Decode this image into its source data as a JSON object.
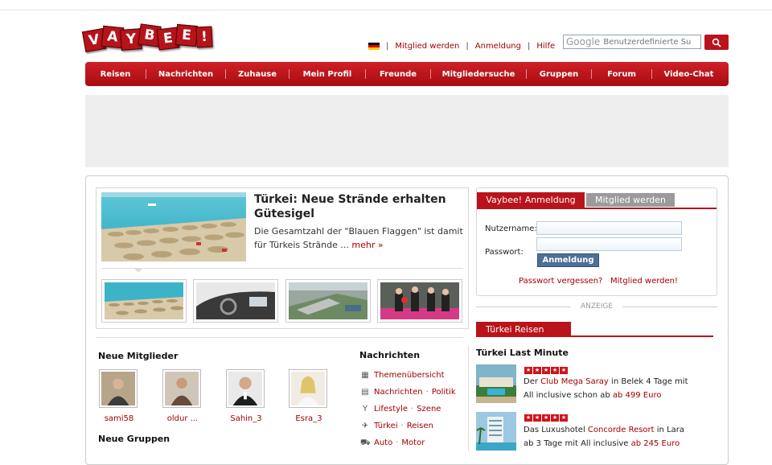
{
  "logo": {
    "letters": [
      "V",
      "A",
      "Y",
      "B",
      "E",
      "E",
      "!"
    ]
  },
  "toplinks": {
    "flag": "german-flag",
    "items": [
      "Mitglied werden",
      "Anmeldung",
      "Hilfe"
    ]
  },
  "search": {
    "brand": "Google",
    "placeholder": "Benutzerdefinierte Su"
  },
  "nav": [
    "Reisen",
    "Nachrichten",
    "Zuhause",
    "Mein Profil",
    "Freunde",
    "Mitgliedersuche",
    "Gruppen",
    "Forum",
    "Video-Chat"
  ],
  "feature": {
    "title": "Türkei: Neue Strände erhalten Gütesigel",
    "text": "Die Gesamtzahl der \"Blauen Flaggen\" ist damit für Türkeis Strände ...",
    "more": "mehr »"
  },
  "login": {
    "tab_active": "Vaybee! Anmeldung",
    "tab_inactive": "Mitglied werden",
    "username_label": "Nutzername:",
    "password_label": "Passwort:",
    "button": "Anmeldung",
    "forgot": "Passwort vergessen?",
    "register": "Mitglied werden!"
  },
  "anzeige": "ANZEIGE",
  "reisen": {
    "tab": "Türkei Reisen",
    "heading": "Türkei Last Minute",
    "offers": [
      {
        "line1_pre": "Der ",
        "hotel": "Club Mega Saray",
        "line1_post": " in Belek 4 Tage mit",
        "line2_pre": "All inclusive schon ab ",
        "price": "ab 499 Euro",
        "stars": 5
      },
      {
        "line1_pre": "Das Luxushotel ",
        "hotel": "Concorde Resort",
        "line1_post": " in Lara",
        "line2_pre": "ab 3 Tage mit All inclusive ",
        "price": "ab 245 Euro",
        "stars": 5
      }
    ]
  },
  "members": {
    "heading": "Neue Mitglieder",
    "items": [
      "sami58",
      "oldur ...",
      "Sahin_3",
      "Esra_3"
    ]
  },
  "groups": {
    "heading": "Neue Gruppen"
  },
  "news": {
    "heading": "Nachrichten",
    "items": [
      {
        "icon": "grid-icon",
        "a": "Themenübersicht",
        "b": ""
      },
      {
        "icon": "newspaper-icon",
        "a": "Nachrichten",
        "b": "Politik"
      },
      {
        "icon": "cocktail-icon",
        "a": "Lifestyle",
        "b": "Szene"
      },
      {
        "icon": "airplane-icon",
        "a": "Türkei",
        "b": "Reisen"
      },
      {
        "icon": "car-icon",
        "a": "Auto",
        "b": "Motor"
      }
    ]
  }
}
